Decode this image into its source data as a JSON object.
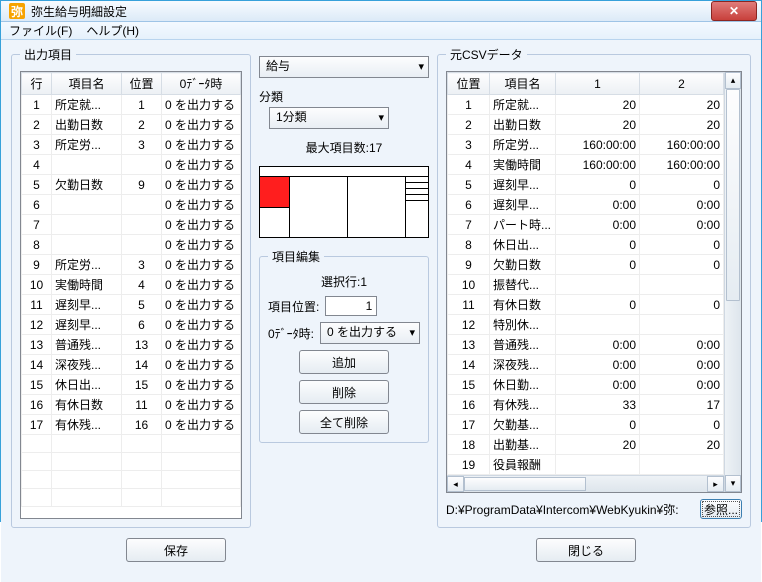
{
  "window": {
    "title": "弥生給与明細設定"
  },
  "menu": {
    "file": "ファイル(F)",
    "help": "ヘルプ(H)"
  },
  "left": {
    "legend": "出力項目",
    "headers": [
      "行",
      "項目名",
      "位置",
      "0ﾃﾞｰﾀ時"
    ],
    "rows": [
      {
        "r": "1",
        "name": "所定就...",
        "pos": "1",
        "z": "0 を出力する"
      },
      {
        "r": "2",
        "name": "出勤日数",
        "pos": "2",
        "z": "0 を出力する"
      },
      {
        "r": "3",
        "name": "所定労...",
        "pos": "3",
        "z": "0 を出力する"
      },
      {
        "r": "4",
        "name": "",
        "pos": "",
        "z": "0 を出力する"
      },
      {
        "r": "5",
        "name": "欠勤日数",
        "pos": "9",
        "z": "0 を出力する"
      },
      {
        "r": "6",
        "name": "",
        "pos": "",
        "z": "0 を出力する"
      },
      {
        "r": "7",
        "name": "",
        "pos": "",
        "z": "0 を出力する"
      },
      {
        "r": "8",
        "name": "",
        "pos": "",
        "z": "0 を出力する"
      },
      {
        "r": "9",
        "name": "所定労...",
        "pos": "3",
        "z": "0 を出力する"
      },
      {
        "r": "10",
        "name": "実働時間",
        "pos": "4",
        "z": "0 を出力する"
      },
      {
        "r": "11",
        "name": "遅刻早...",
        "pos": "5",
        "z": "0 を出力する"
      },
      {
        "r": "12",
        "name": "遅刻早...",
        "pos": "6",
        "z": "0 を出力する"
      },
      {
        "r": "13",
        "name": "普通残...",
        "pos": "13",
        "z": "0 を出力する"
      },
      {
        "r": "14",
        "name": "深夜残...",
        "pos": "14",
        "z": "0 を出力する"
      },
      {
        "r": "15",
        "name": "休日出...",
        "pos": "15",
        "z": "0 を出力する"
      },
      {
        "r": "16",
        "name": "有休日数",
        "pos": "11",
        "z": "0 を出力する"
      },
      {
        "r": "17",
        "name": "有休残...",
        "pos": "16",
        "z": "0 を出力する"
      }
    ]
  },
  "mid": {
    "type_value": "給与",
    "category_label": "分類",
    "category_value": "1分類",
    "max_items": "最大項目数:17",
    "edit_legend": "項目編集",
    "selected_row": "選択行:1",
    "pos_label": "項目位置:",
    "pos_value": "1",
    "zero_label": "0ﾃﾞｰﾀ時:",
    "zero_value": "0 を出力する",
    "btn_add": "追加",
    "btn_del": "削除",
    "btn_delall": "全て削除"
  },
  "right": {
    "legend": "元CSVデータ",
    "headers": [
      "位置",
      "項目名",
      "1",
      "2"
    ],
    "rows": [
      {
        "pos": "1",
        "name": "所定就...",
        "c1": "20",
        "c2": "20"
      },
      {
        "pos": "2",
        "name": "出勤日数",
        "c1": "20",
        "c2": "20"
      },
      {
        "pos": "3",
        "name": "所定労...",
        "c1": "160:00:00",
        "c2": "160:00:00"
      },
      {
        "pos": "4",
        "name": "実働時間",
        "c1": "160:00:00",
        "c2": "160:00:00"
      },
      {
        "pos": "5",
        "name": "遅刻早...",
        "c1": "0",
        "c2": "0"
      },
      {
        "pos": "6",
        "name": "遅刻早...",
        "c1": "0:00",
        "c2": "0:00"
      },
      {
        "pos": "7",
        "name": "パート時...",
        "c1": "0:00",
        "c2": "0:00"
      },
      {
        "pos": "8",
        "name": "休日出...",
        "c1": "0",
        "c2": "0"
      },
      {
        "pos": "9",
        "name": "欠勤日数",
        "c1": "0",
        "c2": "0"
      },
      {
        "pos": "10",
        "name": "振替代...",
        "c1": "",
        "c2": ""
      },
      {
        "pos": "11",
        "name": "有休日数",
        "c1": "0",
        "c2": "0"
      },
      {
        "pos": "12",
        "name": "特別休...",
        "c1": "",
        "c2": ""
      },
      {
        "pos": "13",
        "name": "普通残...",
        "c1": "0:00",
        "c2": "0:00"
      },
      {
        "pos": "14",
        "name": "深夜残...",
        "c1": "0:00",
        "c2": "0:00"
      },
      {
        "pos": "15",
        "name": "休日勤...",
        "c1": "0:00",
        "c2": "0:00"
      },
      {
        "pos": "16",
        "name": "有休残...",
        "c1": "33",
        "c2": "17"
      },
      {
        "pos": "17",
        "name": "欠勤基...",
        "c1": "0",
        "c2": "0"
      },
      {
        "pos": "18",
        "name": "出勤基...",
        "c1": "20",
        "c2": "20"
      },
      {
        "pos": "19",
        "name": "役員報酬",
        "c1": "",
        "c2": ""
      }
    ],
    "path": "D:¥ProgramData¥Intercom¥WebKyukin¥弥:",
    "browse": "参照..."
  },
  "footer": {
    "save": "保存",
    "close": "閉じる"
  }
}
